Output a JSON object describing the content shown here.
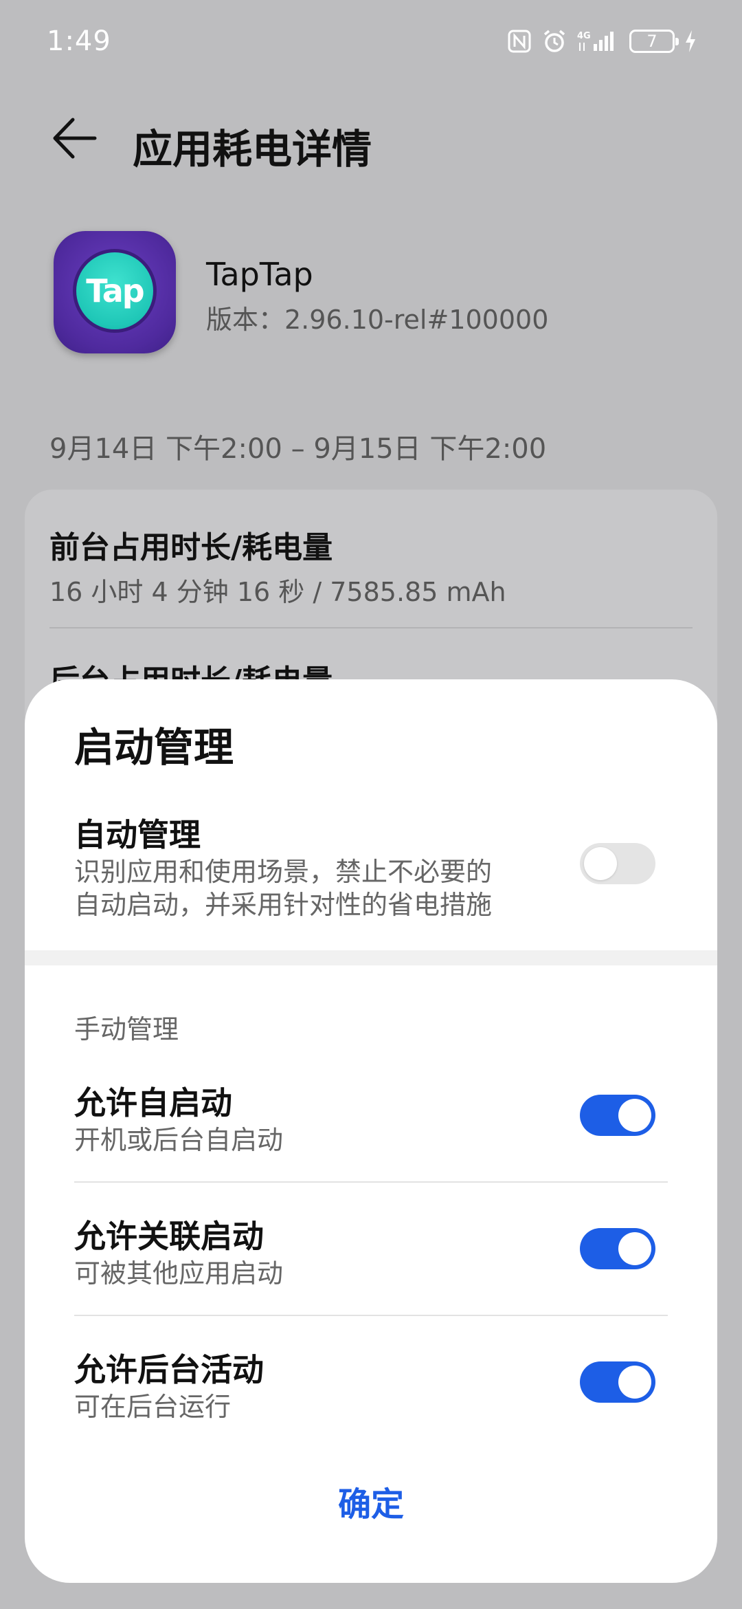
{
  "status_bar": {
    "time": "1:49",
    "network": "4G",
    "battery_level": "7",
    "icons": [
      "nfc-icon",
      "alarm-icon",
      "signal-icon",
      "battery-icon",
      "charging-icon"
    ]
  },
  "header": {
    "title": "应用耗电详情",
    "back_icon": "back-arrow-icon"
  },
  "app": {
    "name": "TapTap",
    "version": "版本：2.96.10-rel#100000",
    "icon_text": "Tap"
  },
  "date_range": "9月14日 下午2:00 – 9月15日 下午2:00",
  "stats": [
    {
      "title": "前台占用时长/耗电量",
      "value": "16 小时 4 分钟 16 秒 / 7585.85 mAh"
    },
    {
      "title": "后台占用时长/耗电量",
      "value": ""
    }
  ],
  "dialog": {
    "title": "启动管理",
    "auto": {
      "title": "自动管理",
      "desc_line1": "识别应用和使用场景，禁止不必要的",
      "desc_line2": "自动启动，并采用针对性的省电措施",
      "enabled": false
    },
    "manual_label": "手动管理",
    "manual_items": [
      {
        "title": "允许自启动",
        "desc": "开机或后台自启动",
        "enabled": true
      },
      {
        "title": "允许关联启动",
        "desc": "可被其他应用启动",
        "enabled": true
      },
      {
        "title": "允许后台活动",
        "desc": "可在后台运行",
        "enabled": true
      }
    ],
    "confirm_label": "确定"
  },
  "colors": {
    "accent": "#1d5ee6",
    "scrim_background": "#bdbdbf",
    "toggle_off": "#e4e4e4"
  }
}
